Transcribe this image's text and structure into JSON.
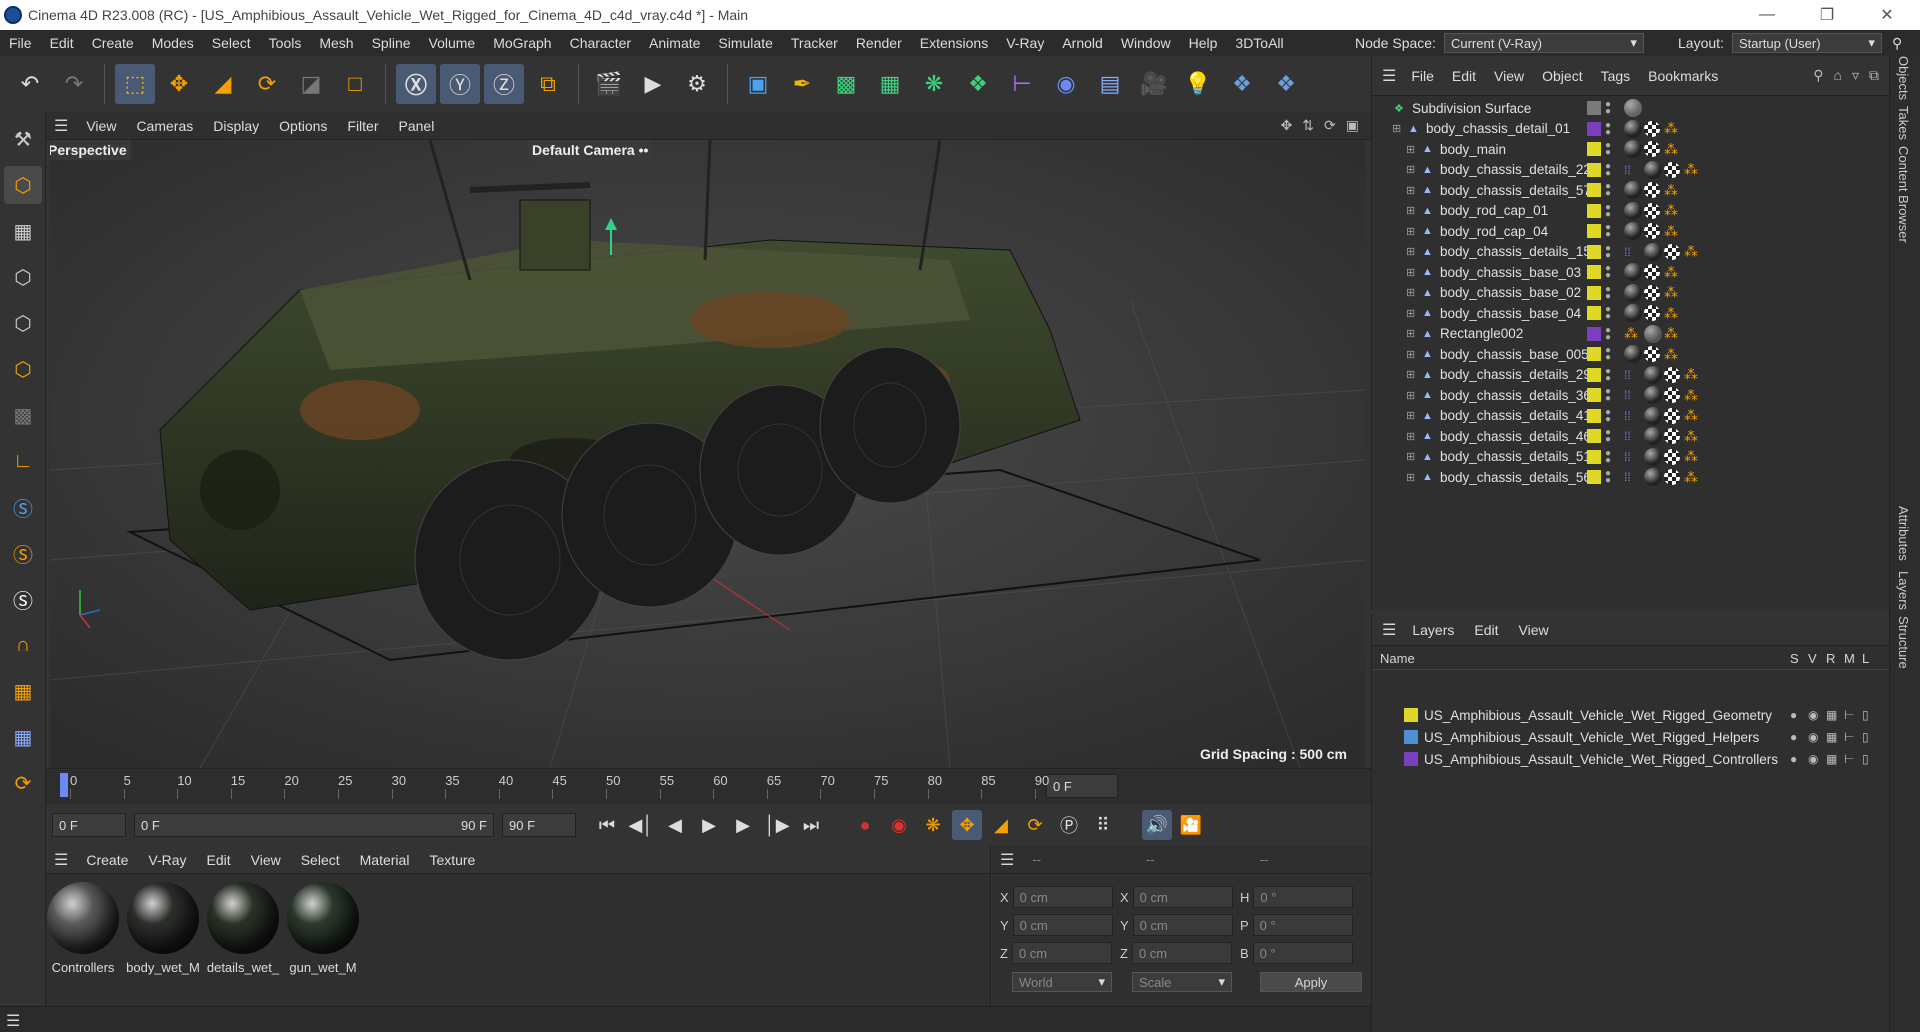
{
  "window": {
    "title": "Cinema 4D R23.008 (RC) - [US_Amphibious_Assault_Vehicle_Wet_Rigged_for_Cinema_4D_c4d_vray.c4d *] - Main"
  },
  "menubar": {
    "items": [
      "File",
      "Edit",
      "Create",
      "Modes",
      "Select",
      "Tools",
      "Mesh",
      "Spline",
      "Volume",
      "MoGraph",
      "Character",
      "Animate",
      "Simulate",
      "Tracker",
      "Render",
      "Extensions",
      "V-Ray",
      "Arnold",
      "Window",
      "Help",
      "3DToAll"
    ],
    "node_space_label": "Node Space:",
    "node_space_value": "Current (V-Ray)",
    "layout_label": "Layout:",
    "layout_value": "Startup (User)"
  },
  "viewport": {
    "menu": [
      "View",
      "Cameras",
      "Display",
      "Options",
      "Filter",
      "Panel"
    ],
    "view_name": "Perspective",
    "camera": "Default Camera",
    "grid_spacing": "Grid Spacing : 500 cm"
  },
  "timeline": {
    "ticks": [
      "0",
      "5",
      "10",
      "15",
      "20",
      "25",
      "30",
      "35",
      "40",
      "45",
      "50",
      "55",
      "60",
      "65",
      "70",
      "75",
      "80",
      "85",
      "90"
    ],
    "current_frame": "0 F"
  },
  "playback": {
    "start": "0 F",
    "range_start": "0 F",
    "range_end": "90 F",
    "end": "90 F"
  },
  "materials": {
    "menu": [
      "Create",
      "V-Ray",
      "Edit",
      "View",
      "Select",
      "Material",
      "Texture"
    ],
    "items": [
      {
        "name": "Controllers",
        "color": "#5a5a5a"
      },
      {
        "name": "body_wet_M",
        "color": "#2c2f2b"
      },
      {
        "name": "details_wet_",
        "color": "#2b3328"
      },
      {
        "name": "gun_wet_M",
        "color": "#2d3a2d"
      }
    ]
  },
  "coords": {
    "header": [
      "--",
      "--",
      "--"
    ],
    "rows": [
      {
        "a": "X",
        "av": "0 cm",
        "b": "X",
        "bv": "0 cm",
        "c": "H",
        "cv": "0 °"
      },
      {
        "a": "Y",
        "av": "0 cm",
        "b": "Y",
        "bv": "0 cm",
        "c": "P",
        "cv": "0 °"
      },
      {
        "a": "Z",
        "av": "0 cm",
        "b": "Z",
        "bv": "0 cm",
        "c": "B",
        "cv": "0 °"
      }
    ],
    "world": "World",
    "scale": "Scale",
    "apply": "Apply"
  },
  "objects": {
    "menu": [
      "File",
      "Edit",
      "View",
      "Object",
      "Tags",
      "Bookmarks"
    ],
    "rows": [
      {
        "name": "Subdivision Surface",
        "indent": 0,
        "color": "#7a7a7a"
      },
      {
        "name": "body_chassis_detail_01",
        "indent": 1,
        "color": "#7b3fbf"
      },
      {
        "name": "body_main",
        "indent": 2,
        "color": "#e1d726"
      },
      {
        "name": "body_chassis_details_22",
        "indent": 2,
        "color": "#e1d726"
      },
      {
        "name": "body_chassis_details_57",
        "indent": 2,
        "color": "#e1d726"
      },
      {
        "name": "body_rod_cap_01",
        "indent": 2,
        "color": "#e1d726"
      },
      {
        "name": "body_rod_cap_04",
        "indent": 2,
        "color": "#e1d726"
      },
      {
        "name": "body_chassis_details_15",
        "indent": 2,
        "color": "#e1d726"
      },
      {
        "name": "body_chassis_base_03",
        "indent": 2,
        "color": "#e1d726"
      },
      {
        "name": "body_chassis_base_02",
        "indent": 2,
        "color": "#e1d726"
      },
      {
        "name": "body_chassis_base_04",
        "indent": 2,
        "color": "#e1d726"
      },
      {
        "name": "Rectangle002",
        "indent": 2,
        "color": "#7b3fbf"
      },
      {
        "name": "body_chassis_base_005",
        "indent": 2,
        "color": "#e1d726"
      },
      {
        "name": "body_chassis_details_29",
        "indent": 2,
        "color": "#e1d726"
      },
      {
        "name": "body_chassis_details_36",
        "indent": 2,
        "color": "#e1d726"
      },
      {
        "name": "body_chassis_details_41",
        "indent": 2,
        "color": "#e1d726"
      },
      {
        "name": "body_chassis_details_46",
        "indent": 2,
        "color": "#e1d726"
      },
      {
        "name": "body_chassis_details_51",
        "indent": 2,
        "color": "#e1d726"
      },
      {
        "name": "body_chassis_details_56",
        "indent": 2,
        "color": "#e1d726"
      }
    ]
  },
  "layers": {
    "menu": [
      "Layers",
      "Edit",
      "View"
    ],
    "col_name": "Name",
    "cols": [
      "S",
      "V",
      "R",
      "M",
      "L"
    ],
    "rows": [
      {
        "name": "US_Amphibious_Assault_Vehicle_Wet_Rigged_Geometry",
        "color": "#e1d726"
      },
      {
        "name": "US_Amphibious_Assault_Vehicle_Wet_Rigged_Helpers",
        "color": "#4f8fd6"
      },
      {
        "name": "US_Amphibious_Assault_Vehicle_Wet_Rigged_Controllers",
        "color": "#7b3fbf"
      }
    ]
  },
  "right_tabs": [
    "Objects",
    "Takes",
    "Content Browser",
    "Attributes",
    "Layers",
    "Structure"
  ]
}
